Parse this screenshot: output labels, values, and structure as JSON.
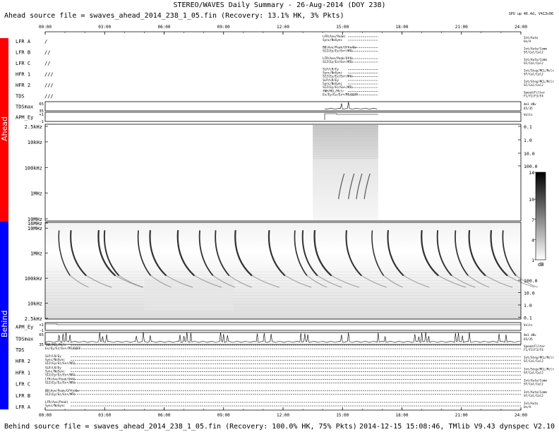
{
  "header": {
    "title": "STEREO/WAVES Daily Summary - 26-Aug-2014 (DOY 238)",
    "ahead_source": "Ahead source file = swaves_ahead_2014_238_1_05.fin (Recovery: 13.1% HK, 3% Pkts)",
    "uptime": "SPU up 46.4d, V413c06"
  },
  "footer": {
    "behind_source": "Behind source file = swaves_ahead_2014_238_1_05.fin (Recovery: 100.0% HK, 75% Pkts)",
    "right": "2014-12-15 15:08:46, TMlib V9.43 dynspec V2.10"
  },
  "sides": {
    "ahead": "Ahead",
    "behind": "Behind"
  },
  "time_ticks": [
    "00:00",
    "03:00",
    "06:00",
    "09:00",
    "12:00",
    "15:00",
    "18:00",
    "21:00",
    "24:00"
  ],
  "ahead_rows": [
    {
      "label": "LFR A",
      "mark": "/",
      "texts": [
        "LFR(Ave/Peak)",
        "Sync/NoSync"
      ],
      "right": [
        "Int/Auto",
        "On/A"
      ]
    },
    {
      "label": "LFR B",
      "mark": "//",
      "texts": [
        "BB(Ave/Peak/Off)/Ov",
        "SIZ(Ey/Ez/Ex+/MT)"
      ],
      "right": [
        "Int/Auto/Comm",
        "SF/Cal/Cal2"
      ]
    },
    {
      "label": "LFR C",
      "mark": "//",
      "texts": [
        "LFR(Ave/Peak/Off)",
        "SIZ(Ey/Ez/Ex+/MT)"
      ],
      "right": [
        "Int/Auto/Comm",
        "SF/Cal/Cal2"
      ]
    },
    {
      "label": "HFR 1",
      "mark": "///",
      "texts": [
        "SLP/LR/Ey",
        "Sync/NoSync",
        "SIZ(Ey/Ez/Ex+/MT)"
      ],
      "right": [
        "Int/Step/MCL/Mclr",
        "SF/Cal/Cal2"
      ]
    },
    {
      "label": "HFR 2",
      "mark": "///",
      "texts": [
        "SLP/LR/Ey",
        "Sync/NoSync",
        "SIZ(Ey/Ez/Ex+/MT)"
      ],
      "right": [
        "Int/Step/MCL/Mclr",
        "SF/Cal/Cal2"
      ]
    },
    {
      "label": "TDS",
      "mark": "///",
      "texts": [
        "TNR/MCL/Mclr",
        "Ex/Ey/Ez/Ex+/MT/DIFF"
      ],
      "right": [
        "Speed/Filter",
        "F1/F2/F3/F4"
      ]
    }
  ],
  "behind_rows": [
    {
      "label": "TDS",
      "texts": [
        "TNR/MCL/Mclr",
        "Ex/Ey/Ez/Ex+/MT/DIFF"
      ],
      "right": [
        "Speed/Filter",
        "F1/F2/F3/F4"
      ]
    },
    {
      "label": "HFR 2",
      "texts": [
        "SLP/LR/Ey",
        "Sync/NoSync",
        "SIZ(Ey/Ez/Ex+/MT)"
      ],
      "right": [
        "Int/Step/MCL/Mclr",
        "SF/Cal/Cal2"
      ]
    },
    {
      "label": "HFR 1",
      "texts": [
        "SLP/LR/Ey",
        "Sync/NoSync",
        "SIZ(Ey/Ez/Ex+/MT)"
      ],
      "right": [
        "Int/Step/MCL/Mclr",
        "SF/Cal/Cal2"
      ]
    },
    {
      "label": "LFR C",
      "texts": [
        "LFR(Ave/Peak/Off)",
        "SIZ(Ey/Ez/Ex+/MT)"
      ],
      "right": [
        "Int/Auto/Comm",
        "SF/Cal/Cal2"
      ]
    },
    {
      "label": "LFR B",
      "texts": [
        "BB(Ave/Peak/Off)/Ov",
        "SIZ(Ey/Ez/Ex+/MT)"
      ],
      "right": [
        "Int/Auto/Comm",
        "SF/Cal/Cal2"
      ]
    },
    {
      "label": "LFR A",
      "texts": [
        "LFR(Ave/Peak)",
        "Sync/NoSync"
      ],
      "right": [
        "Int/Auto",
        "On/A"
      ]
    }
  ],
  "small_panels": {
    "ahead_tdsmax": {
      "label": "TDSmax",
      "ticks": [
        "65",
        "35"
      ],
      "right": [
        "4m1 dBv",
        "65/35"
      ]
    },
    "ahead_apmv": {
      "label": "APM_Ey",
      "ticks": [
        "+1",
        "-1"
      ],
      "right": [
        "Volts"
      ]
    },
    "behind_apmv": {
      "label": "APM_Ey",
      "ticks": [
        "+1",
        "-1"
      ],
      "right": [
        "Volts"
      ]
    },
    "behind_tdsmax": {
      "label": "TDSmax",
      "ticks": [
        "65",
        "35"
      ],
      "right": [
        "4m1 dBv",
        "65/35"
      ]
    }
  },
  "spectrum": {
    "ahead_left_ticks": [
      "2.5kHz",
      "10kHz",
      "100kHz",
      "1MHz",
      "10MHz"
    ],
    "ahead_right_ticks": [
      "0.1",
      "1.0",
      "10.0",
      "100.0"
    ],
    "behind_left_ticks": [
      "16MHz",
      "10MHz",
      "1MHz",
      "100kHz",
      "10kHz",
      "2.5kHz"
    ],
    "behind_right_ticks": [
      "100.0",
      "10.0",
      "1.0",
      "0.1"
    ],
    "colorbar_ticks": [
      "14",
      "10",
      "7",
      "4",
      "1"
    ],
    "colorbar_unit": "dB"
  },
  "chart_data": {
    "type": "heatmap",
    "title": "STEREO/WAVES Daily Summary - 26-Aug-2014 (DOY 238)",
    "x_unit": "UT hours",
    "xlim": [
      0,
      24
    ],
    "x_ticks": [
      "00:00",
      "03:00",
      "06:00",
      "09:00",
      "12:00",
      "15:00",
      "18:00",
      "21:00",
      "24:00"
    ],
    "ahead_y": [
      "2.5kHz",
      "10kHz",
      "100kHz",
      "1MHz",
      "10MHz"
    ],
    "behind_y": [
      "16MHz",
      "10MHz",
      "1MHz",
      "100kHz",
      "10kHz",
      "2.5kHz"
    ],
    "intensity_scale_db": [
      1,
      14
    ],
    "ahead_data_coverage_hours": [
      13.5,
      16.8
    ],
    "behind_type3_burst_times_hours": [
      0.7,
      1.3,
      2.7,
      3.0,
      4.7,
      5.3,
      6.7,
      7.8,
      8.6,
      9.6,
      11.3,
      12.6,
      13.0,
      13.6,
      15.2,
      16.5,
      17.3,
      19.0,
      19.8,
      20.7,
      21.4,
      22.5,
      23.1
    ]
  }
}
